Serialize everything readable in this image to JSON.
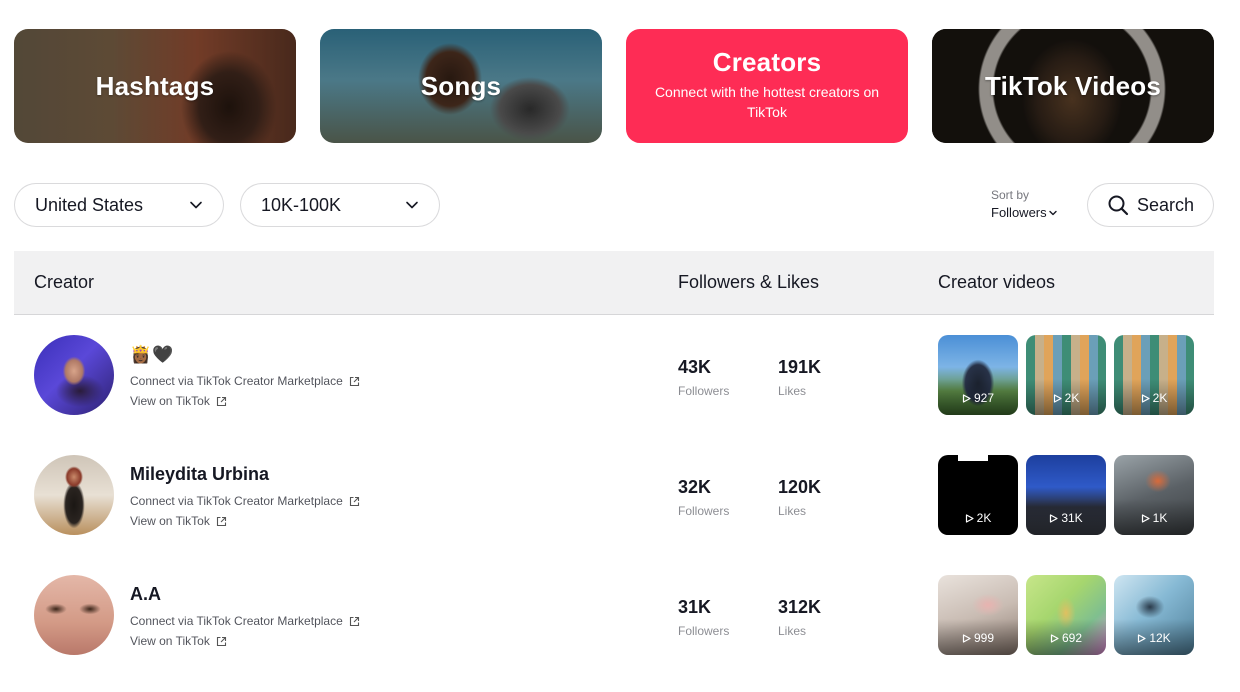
{
  "categories": {
    "hashtags": {
      "title": "Hashtags"
    },
    "songs": {
      "title": "Songs"
    },
    "creators": {
      "title": "Creators",
      "subtitle": "Connect with the hottest creators on TikTok",
      "active": true,
      "color": "#fe2c55"
    },
    "videos": {
      "title": "TikTok Videos"
    }
  },
  "filters": {
    "country": {
      "value": "United States",
      "icon": "chevron-down-icon"
    },
    "followers": {
      "value": "10K-100K",
      "icon": "chevron-down-icon"
    },
    "sort": {
      "label": "Sort by",
      "value": "Followers",
      "icon": "chevron-down-icon"
    },
    "search": {
      "label": "Search",
      "icon": "search-icon"
    }
  },
  "table": {
    "headers": {
      "creator": "Creator",
      "followers_likes": "Followers & Likes",
      "videos": "Creator videos"
    },
    "rows": [
      {
        "name": "👸🏾🖤",
        "marketplace_link": "Connect via TikTok Creator Marketplace",
        "view_link": "View on TikTok",
        "followers": "43K",
        "followers_label": "Followers",
        "likes": "191K",
        "likes_label": "Likes",
        "videos": [
          {
            "plays": "927"
          },
          {
            "plays": "2K"
          },
          {
            "plays": "2K"
          }
        ]
      },
      {
        "name": "Mileydita Urbina",
        "marketplace_link": "Connect via TikTok Creator Marketplace",
        "view_link": "View on TikTok",
        "followers": "32K",
        "followers_label": "Followers",
        "likes": "120K",
        "likes_label": "Likes",
        "videos": [
          {
            "plays": "2K"
          },
          {
            "plays": "31K"
          },
          {
            "plays": "1K"
          }
        ]
      },
      {
        "name": "A.A",
        "marketplace_link": "Connect via TikTok Creator Marketplace",
        "view_link": "View on TikTok",
        "followers": "31K",
        "followers_label": "Followers",
        "likes": "312K",
        "likes_label": "Likes",
        "videos": [
          {
            "plays": "999"
          },
          {
            "plays": "692"
          },
          {
            "plays": "12K"
          }
        ]
      }
    ]
  }
}
